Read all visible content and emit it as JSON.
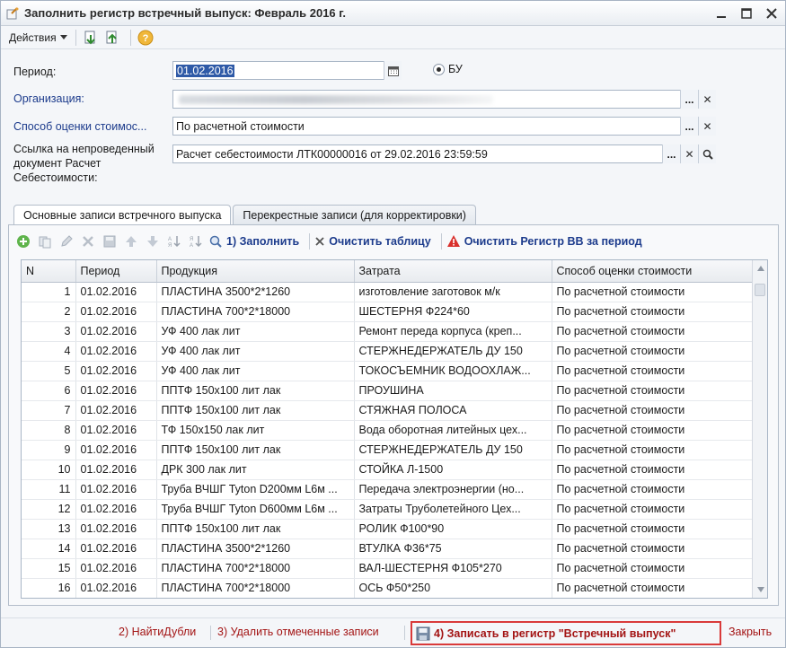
{
  "window": {
    "title": "Заполнить регистр встречный выпуск: Февраль 2016 г."
  },
  "toolbar": {
    "actions_label": "Действия"
  },
  "form": {
    "period_label": "Период:",
    "period_value": "01.02.2016",
    "radio_label": "БУ",
    "org_label": "Организация:",
    "method_label": "Способ оценки стоимос...",
    "method_value": "По расчетной стоимости",
    "ref_label": "Ссылка на непроведенный документ Расчет Себестоимости:",
    "ref_value": "Расчет себестоимости ЛТК00000016 от 29.02.2016 23:59:59"
  },
  "tabs": [
    {
      "label": "Основные записи встречного выпуска",
      "active": true
    },
    {
      "label": "Перекрестные записи (для корректировки)",
      "active": false
    }
  ],
  "table_toolbar": {
    "fill_label": "1) Заполнить",
    "clear_label": "Очистить таблицу",
    "clear_reg_label": "Очистить Регистр ВВ за период"
  },
  "table": {
    "columns": [
      "N",
      "Период",
      "Продукция",
      "Затрата",
      "Способ оценки стоимости"
    ],
    "rows": [
      [
        "1",
        "01.02.2016",
        "ПЛАСТИНА 3500*2*1260",
        "изготовление заготовок м/к",
        "По расчетной стоимости"
      ],
      [
        "2",
        "01.02.2016",
        "ПЛАСТИНА 700*2*18000",
        "ШЕСТЕРНЯ Ф224*60",
        "По расчетной стоимости"
      ],
      [
        "3",
        "01.02.2016",
        "УФ 400 лак лит",
        "Ремонт переда корпуса (креп...",
        "По расчетной стоимости"
      ],
      [
        "4",
        "01.02.2016",
        "УФ 400 лак лит",
        "СТЕРЖНЕДЕРЖАТЕЛЬ ДУ 150",
        "По расчетной стоимости"
      ],
      [
        "5",
        "01.02.2016",
        "УФ 400 лак лит",
        "ТОКОСЪЕМНИК ВОДООХЛАЖ...",
        "По расчетной стоимости"
      ],
      [
        "6",
        "01.02.2016",
        "ППТФ 150х100 лит лак",
        "ПРОУШИНА",
        "По расчетной стоимости"
      ],
      [
        "7",
        "01.02.2016",
        "ППТФ 150х100 лит лак",
        "СТЯЖНАЯ ПОЛОСА",
        "По расчетной стоимости"
      ],
      [
        "8",
        "01.02.2016",
        "ТФ 150х150 лак лит",
        "Вода оборотная литейных цех...",
        "По расчетной стоимости"
      ],
      [
        "9",
        "01.02.2016",
        "ППТФ 150х100 лит лак",
        "СТЕРЖНЕДЕРЖАТЕЛЬ ДУ 150",
        "По расчетной стоимости"
      ],
      [
        "10",
        "01.02.2016",
        "ДРК 300 лак лит",
        "СТОЙКА Л-1500",
        "По расчетной стоимости"
      ],
      [
        "11",
        "01.02.2016",
        "Труба ВЧШГ Tyton D200мм L6м ...",
        "Передача электроэнергии (но...",
        "По расчетной стоимости"
      ],
      [
        "12",
        "01.02.2016",
        "Труба ВЧШГ Tyton D600мм L6м ...",
        "Затраты Труболетейного Цех...",
        "По расчетной стоимости"
      ],
      [
        "13",
        "01.02.2016",
        "ППТФ 150х100 лит лак",
        "РОЛИК Ф100*90",
        "По расчетной стоимости"
      ],
      [
        "14",
        "01.02.2016",
        "ПЛАСТИНА 3500*2*1260",
        "ВТУЛКА Ф36*75",
        "По расчетной стоимости"
      ],
      [
        "15",
        "01.02.2016",
        "ПЛАСТИНА 700*2*18000",
        "ВАЛ-ШЕСТЕРНЯ Ф105*270",
        "По расчетной стоимости"
      ],
      [
        "16",
        "01.02.2016",
        "ПЛАСТИНА 700*2*18000",
        "ОСЬ Ф50*250",
        "По расчетной стоимости"
      ]
    ]
  },
  "bottom": {
    "find_dup_label": "2) НайтиДубли",
    "delete_marked_label": "3) Удалить отмеченные записи",
    "write_label": "4) Записать в регистр \"Встречный выпуск\"",
    "close_label": "Закрыть"
  },
  "colors": {
    "accent_link": "#1c3b8c",
    "bottom_link": "#a31414",
    "highlight_border": "#d93a3a"
  }
}
